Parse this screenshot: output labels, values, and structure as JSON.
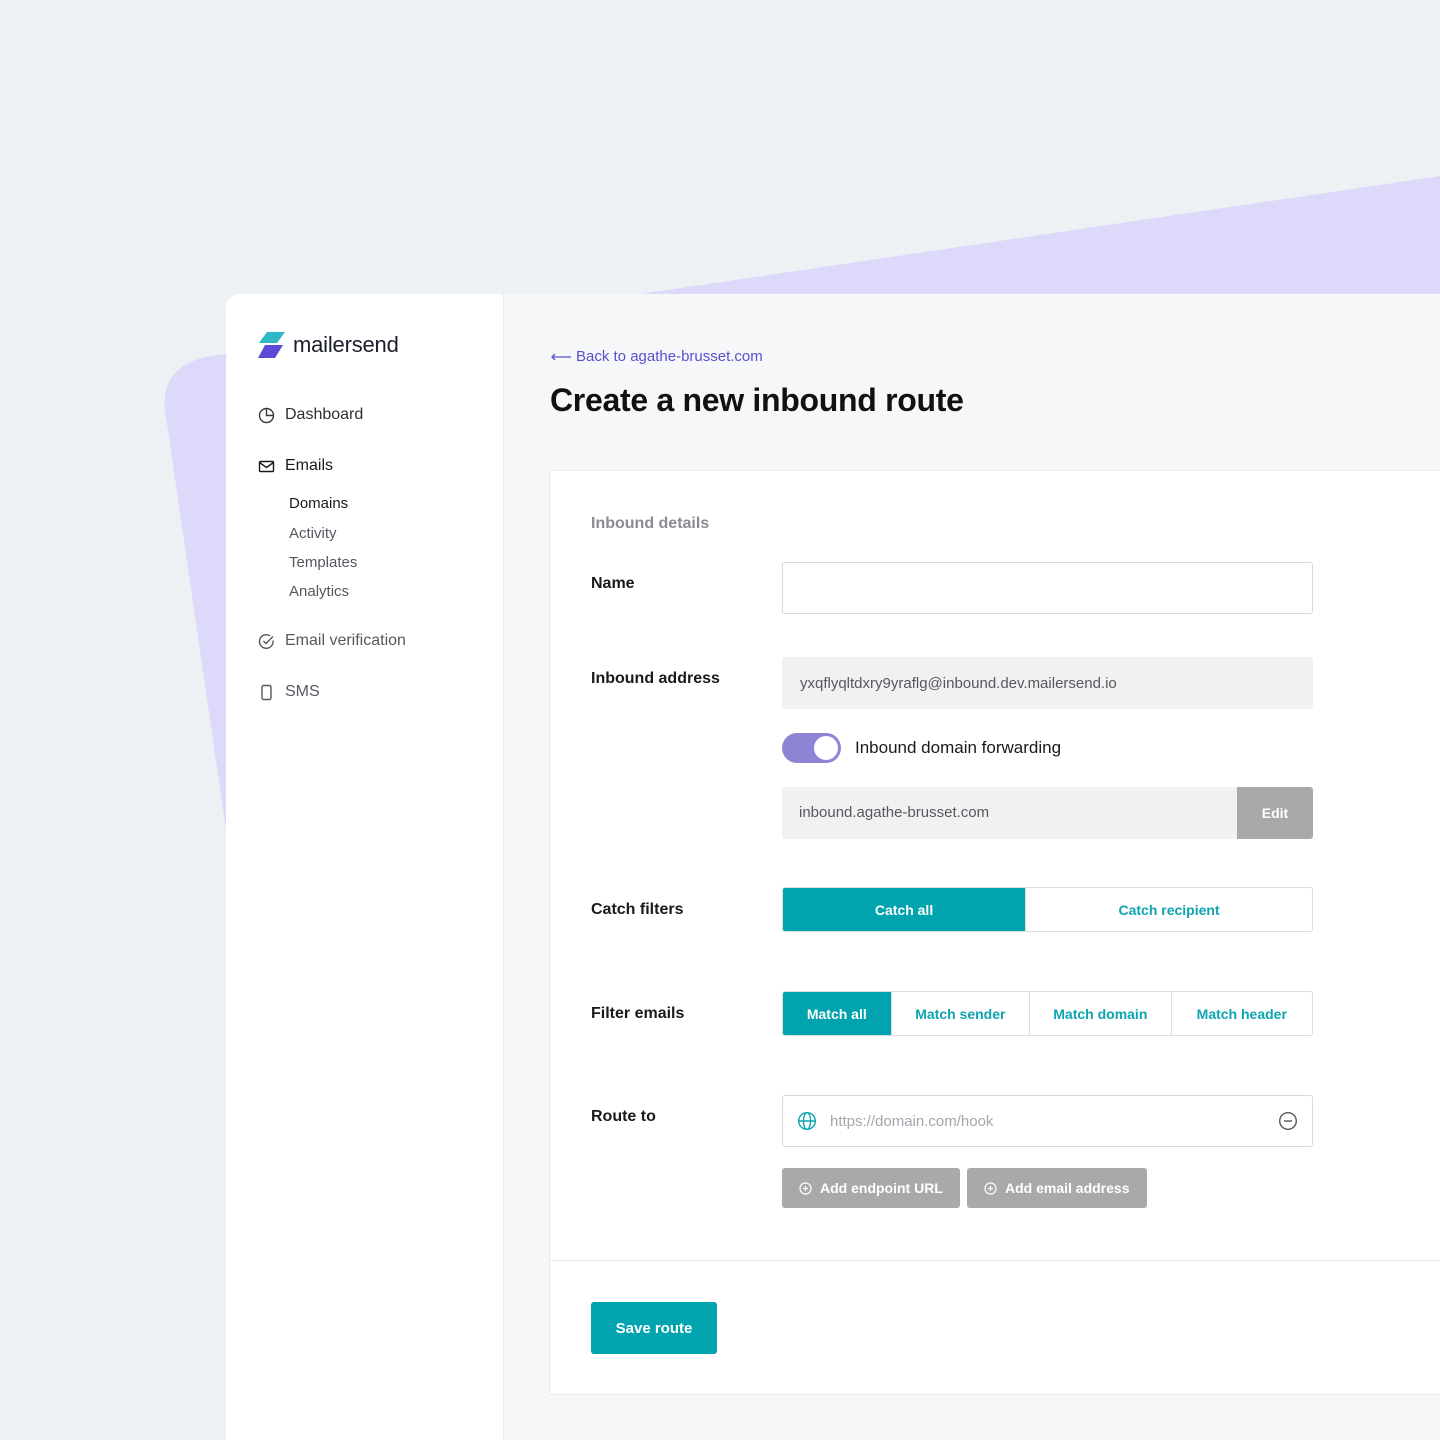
{
  "brand": {
    "name": "mailersend"
  },
  "sidebar": {
    "items": [
      {
        "label": "Dashboard",
        "icon": "pie-chart-icon"
      },
      {
        "label": "Emails",
        "icon": "envelope-icon"
      },
      {
        "label": "Email verification",
        "icon": "check-circle-icon"
      },
      {
        "label": "SMS",
        "icon": "phone-icon"
      }
    ],
    "subitems": [
      {
        "label": "Domains",
        "active": true
      },
      {
        "label": "Activity"
      },
      {
        "label": "Templates"
      },
      {
        "label": "Analytics"
      }
    ]
  },
  "header": {
    "back_link": "Back to agathe-brusset.com",
    "title": "Create a new inbound route"
  },
  "form": {
    "section_title": "Inbound details",
    "name": {
      "label": "Name",
      "value": ""
    },
    "inbound_address": {
      "label": "Inbound address",
      "value": "yxqflyqltdxry9yraflg@inbound.dev.mailersend.io"
    },
    "forwarding": {
      "label": "Inbound domain forwarding",
      "enabled": true,
      "domain": "inbound.agathe-brusset.com",
      "edit_label": "Edit"
    },
    "catch_filters": {
      "label": "Catch filters",
      "options": [
        "Catch all",
        "Catch recipient"
      ],
      "selected": "Catch all"
    },
    "filter_emails": {
      "label": "Filter emails",
      "options": [
        "Match all",
        "Match sender",
        "Match domain",
        "Match header"
      ],
      "selected": "Match all"
    },
    "route_to": {
      "label": "Route to",
      "placeholder": "https://domain.com/hook",
      "add_endpoint_label": "Add endpoint URL",
      "add_email_label": "Add email address"
    },
    "save_label": "Save route"
  },
  "colors": {
    "accent": "#00a3ae",
    "toggle": "#8e84d6",
    "link": "#5a4fcf",
    "decor": "#ddd9fb"
  }
}
